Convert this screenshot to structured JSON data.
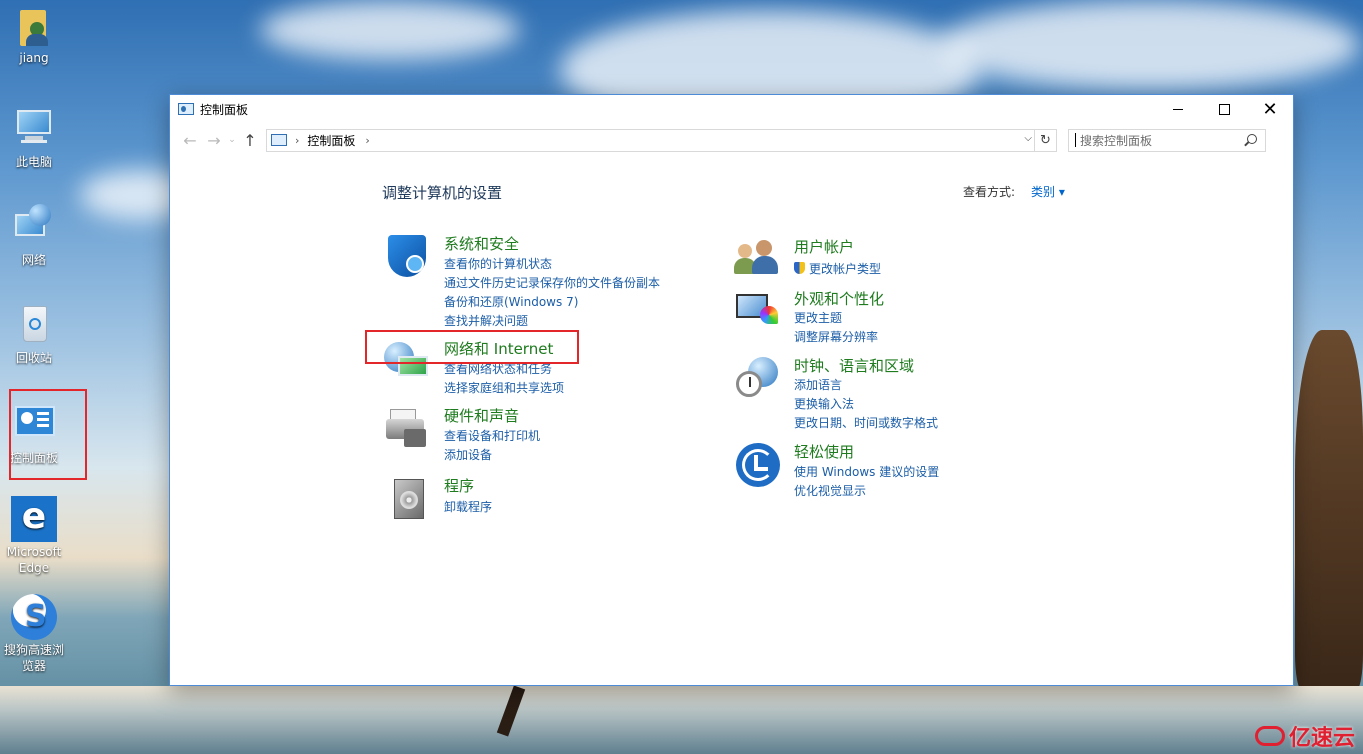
{
  "desktop": {
    "icons": [
      {
        "label": "jiang"
      },
      {
        "label": "此电脑"
      },
      {
        "label": "网络"
      },
      {
        "label": "回收站"
      },
      {
        "label": "控制面板"
      },
      {
        "label": "Microsoft Edge"
      },
      {
        "label": "搜狗高速浏览器"
      }
    ]
  },
  "window": {
    "title": "控制面板",
    "controls": {
      "minimize": "",
      "maximize": "",
      "close": "✕"
    },
    "nav": {
      "back": "←",
      "forward": "→",
      "dropdown": "⌄",
      "up": "↑",
      "sep": "›",
      "refresh": "↻",
      "addr_dropdown": "⌵"
    },
    "address": {
      "path": "控制面板"
    },
    "search": {
      "placeholder": "搜索控制面板"
    },
    "content": {
      "heading": "调整计算机的设置",
      "view_by_label": "查看方式:",
      "view_by_value": "类别 ▾",
      "categories": [
        {
          "title": "系统和安全",
          "icon": "shield-icon",
          "links": [
            "查看你的计算机状态",
            "通过文件历史记录保存你的文件备份副本",
            "备份和还原(Windows 7)",
            "查找并解决问题"
          ]
        },
        {
          "title": "网络和 Internet",
          "icon": "network-globe-icon",
          "links": [
            "查看网络状态和任务",
            "选择家庭组和共享选项"
          ]
        },
        {
          "title": "硬件和声音",
          "icon": "printer-icon",
          "links": [
            "查看设备和打印机",
            "添加设备"
          ]
        },
        {
          "title": "程序",
          "icon": "programs-icon",
          "links": [
            "卸载程序"
          ]
        },
        {
          "title": "用户帐户",
          "icon": "users-icon",
          "links": [
            "更改帐户类型"
          ]
        },
        {
          "title": "外观和个性化",
          "icon": "monitor-palette-icon",
          "links": [
            "更改主题",
            "调整屏幕分辨率"
          ]
        },
        {
          "title": "时钟、语言和区域",
          "icon": "clock-globe-icon",
          "links": [
            "添加语言",
            "更换输入法",
            "更改日期、时间或数字格式"
          ]
        },
        {
          "title": "轻松使用",
          "icon": "ease-of-access-icon",
          "links": [
            "使用 Windows 建议的设置",
            "优化视觉显示"
          ]
        }
      ]
    }
  },
  "watermark": {
    "text": "亿速云"
  },
  "colors": {
    "accent_link": "#1c5ea8",
    "category_title": "#1e7b1e",
    "highlight": "#e2262a"
  }
}
